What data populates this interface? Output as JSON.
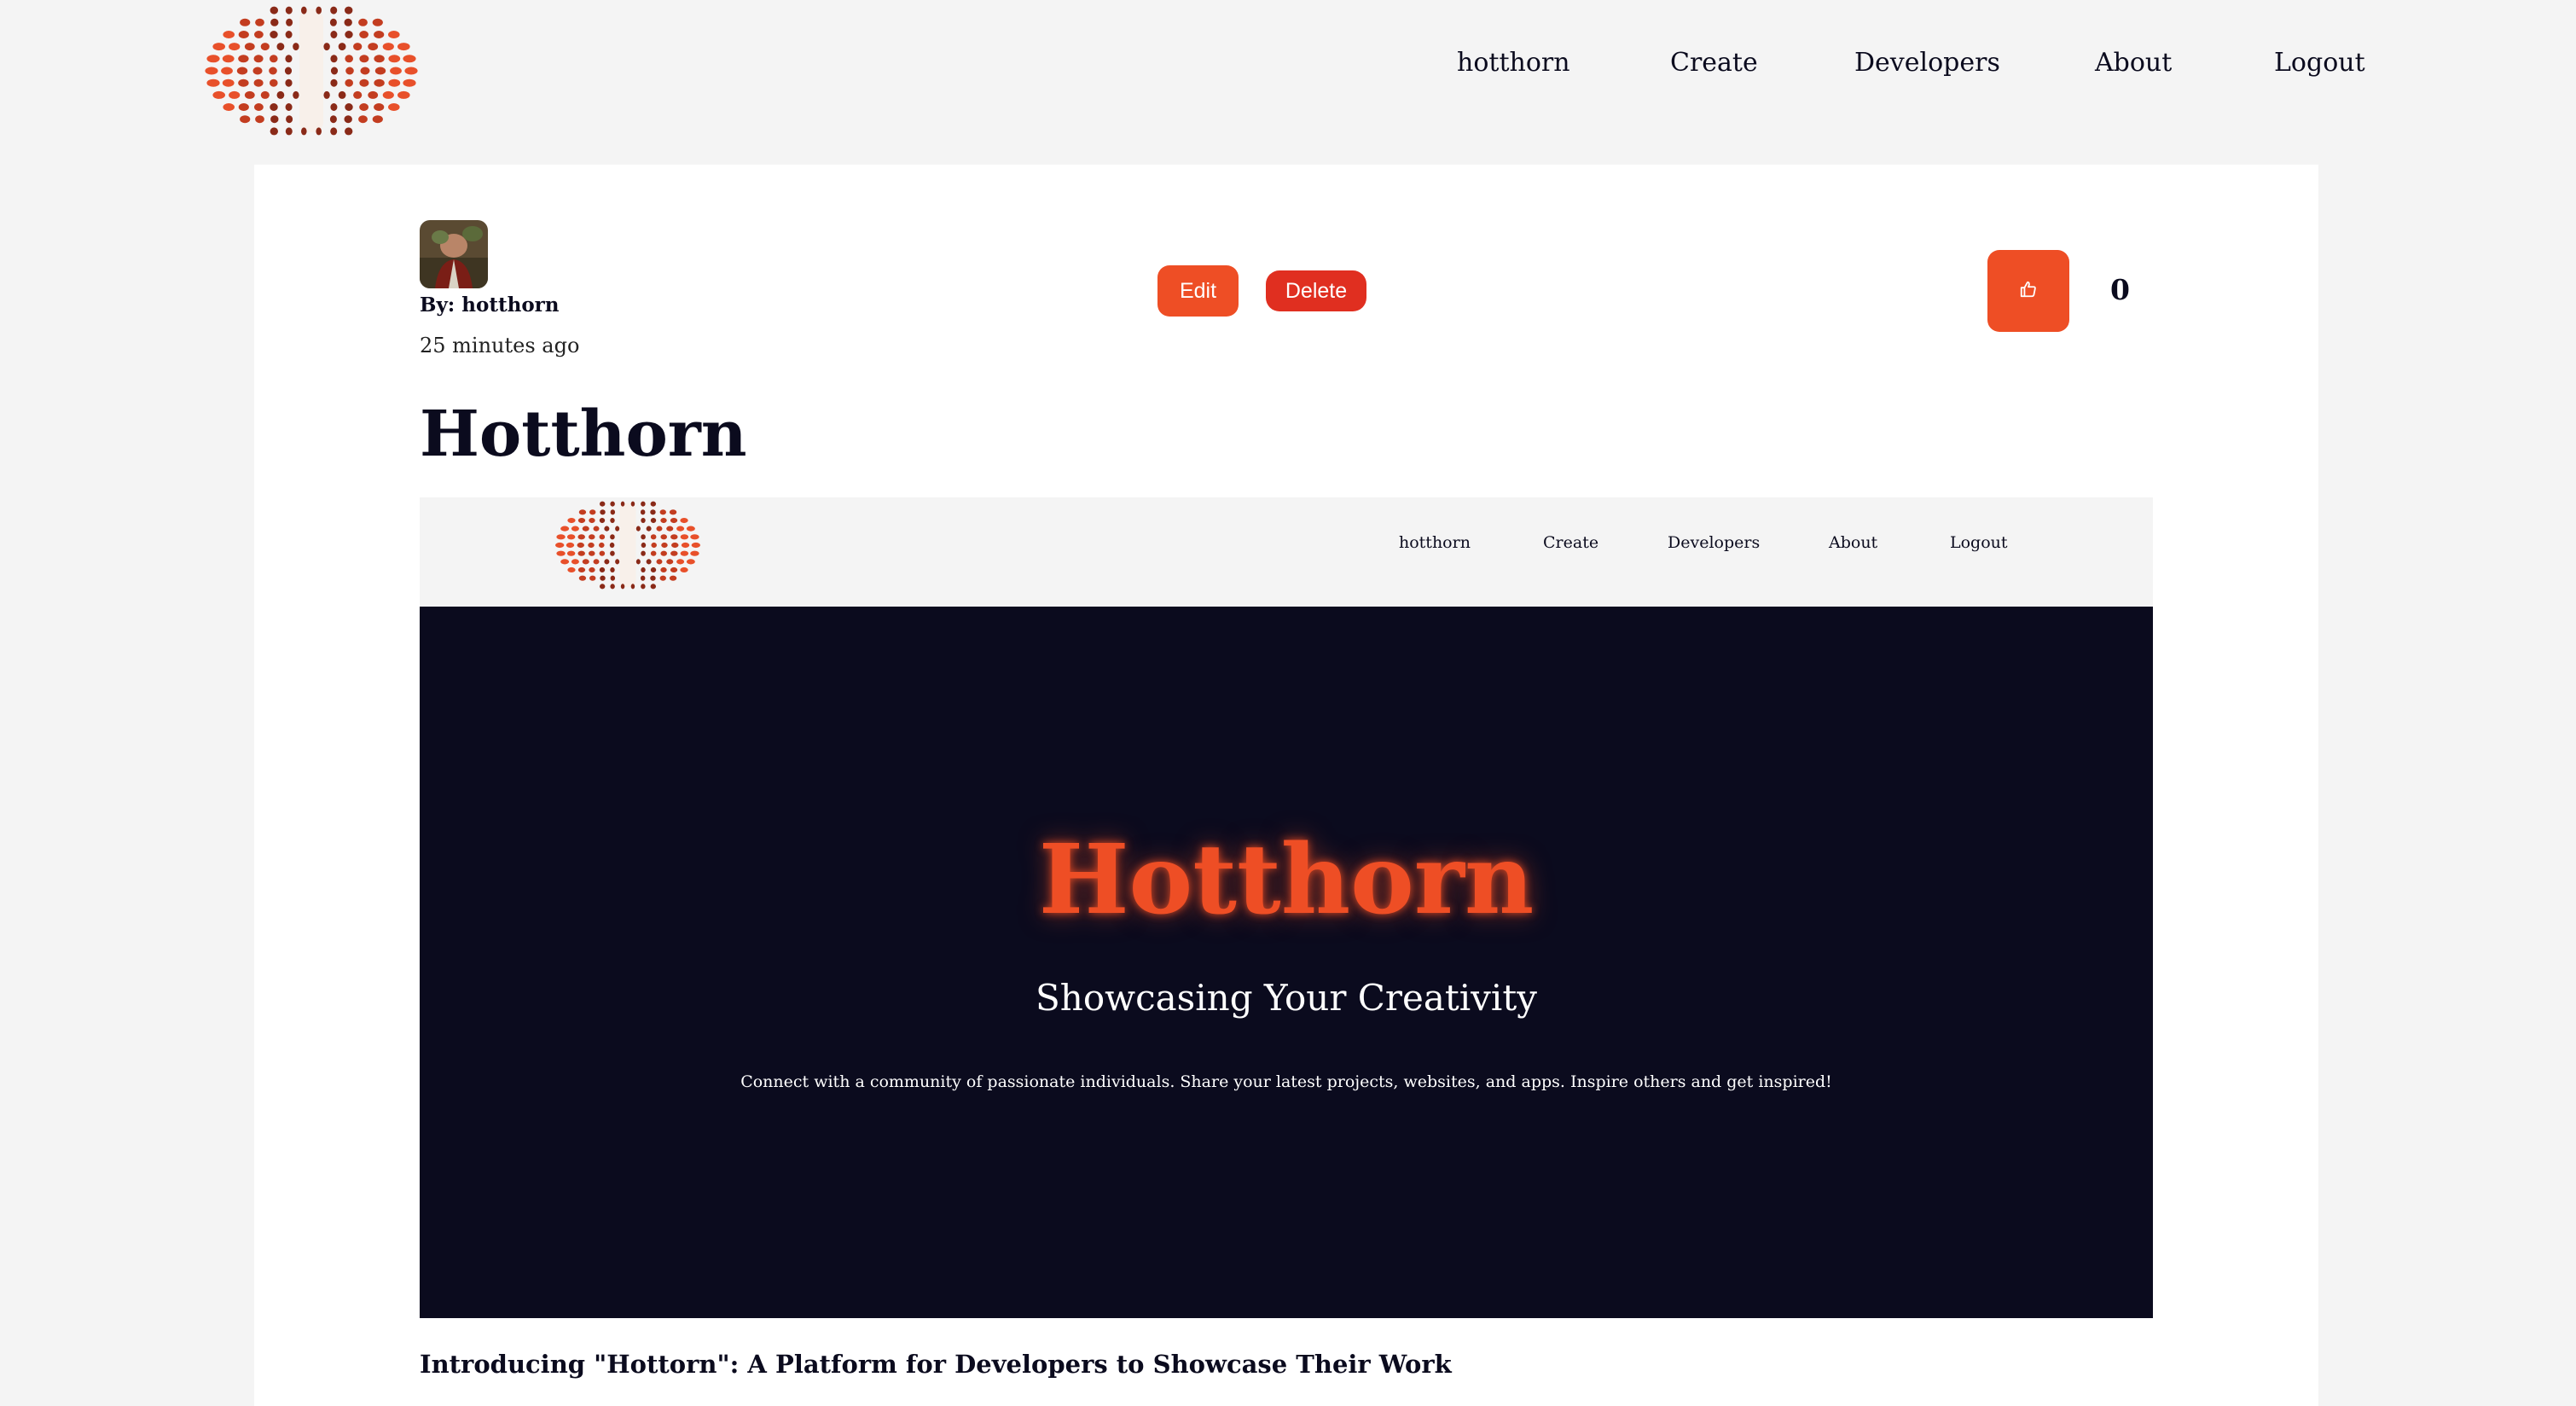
{
  "nav": {
    "links": [
      "hotthorn",
      "Create",
      "Developers",
      "About",
      "Logout"
    ]
  },
  "post": {
    "author_line": "By: hotthorn",
    "time_ago": "25 minutes ago",
    "edit_label": "Edit",
    "delete_label": "Delete",
    "like_count": "0",
    "title": "Hotthorn",
    "intro": "Introducing \"Hottorn\": A Platform for Developers to Showcase Their Work"
  },
  "screenshot": {
    "nav_links": [
      "hotthorn",
      "Create",
      "Developers",
      "About",
      "Logout"
    ],
    "hero_title": "Hotthorn",
    "hero_subtitle": "Showcasing Your Creativity",
    "hero_description": "Connect with a community of passionate individuals. Share your latest projects, websites, and apps. Inspire others and get inspired!"
  },
  "colors": {
    "accent": "#ee4e25",
    "delete": "#e02f20",
    "dark": "#0b0b1e",
    "background": "#f4f4f4"
  },
  "icons": [
    "logo-icon",
    "thumbs-up-icon"
  ]
}
